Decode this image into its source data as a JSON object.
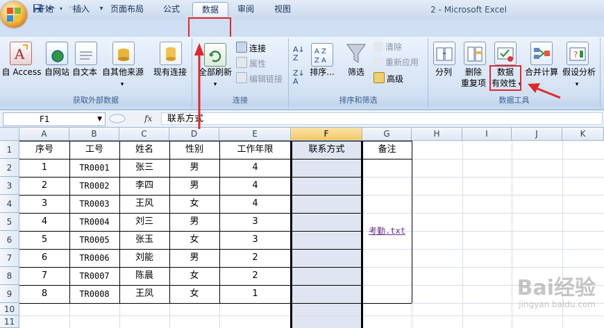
{
  "window": {
    "title": "2 - Microsoft Excel"
  },
  "tabs": [
    {
      "label": "开始"
    },
    {
      "label": "插入"
    },
    {
      "label": "页面布局"
    },
    {
      "label": "公式"
    },
    {
      "label": "数据",
      "active": true
    },
    {
      "label": "审阅"
    },
    {
      "label": "视图"
    }
  ],
  "ribbon": {
    "external": {
      "group_label": "获取外部数据",
      "access": "自 Access",
      "web": "自网站",
      "text": "自文本",
      "other": "自其他来源",
      "existing": "现有连接"
    },
    "connections": {
      "group_label": "连接",
      "refresh": "全部刷新",
      "connections": "连接",
      "properties": "属性",
      "edit_links": "编辑链接"
    },
    "sort": {
      "group_label": "排序和筛选",
      "sort": "排序...",
      "filter": "筛选",
      "clear": "清除",
      "reapply": "重新应用",
      "advanced": "高级"
    },
    "tools": {
      "group_label": "数据工具",
      "text_to_columns": "分列",
      "remove_dup_1": "删除",
      "remove_dup_2": "重复项",
      "validation_1": "数据",
      "validation_2": "有效性",
      "consolidate": "合并计算",
      "what_if": "假设分析"
    }
  },
  "formula_bar": {
    "name_box": "F1",
    "fx": "fx",
    "content": "联系方式"
  },
  "columns": [
    "A",
    "B",
    "C",
    "D",
    "E",
    "F",
    "G",
    "H",
    "I",
    "J",
    "K"
  ],
  "rows": [
    "1",
    "2",
    "3",
    "4",
    "5",
    "6",
    "7",
    "8",
    "9",
    "10",
    "11"
  ],
  "sheet": {
    "headers": [
      "序号",
      "工号",
      "姓名",
      "性别",
      "工作年限",
      "联系方式",
      "备注"
    ],
    "data": [
      [
        "1",
        "TR0001",
        "张三",
        "男",
        "4"
      ],
      [
        "2",
        "TR0002",
        "李四",
        "男",
        "4"
      ],
      [
        "3",
        "TR0003",
        "王风",
        "女",
        "4"
      ],
      [
        "4",
        "TR0004",
        "刘三",
        "男",
        "3"
      ],
      [
        "5",
        "TR0005",
        "张玉",
        "女",
        "3"
      ],
      [
        "6",
        "TR0006",
        "刘能",
        "男",
        "2"
      ],
      [
        "7",
        "TR0007",
        "陈晨",
        "女",
        "2"
      ],
      [
        "8",
        "TR0008",
        "王凤",
        "女",
        "1"
      ]
    ],
    "note_link": "考勤.txt"
  },
  "watermark": {
    "brand": "Bai经验",
    "url": "jingyan.baidu.com"
  },
  "colors": {
    "annotation_red": "#e0282a",
    "selected_column": "#dfe6f1",
    "link": "#6b2c91"
  }
}
